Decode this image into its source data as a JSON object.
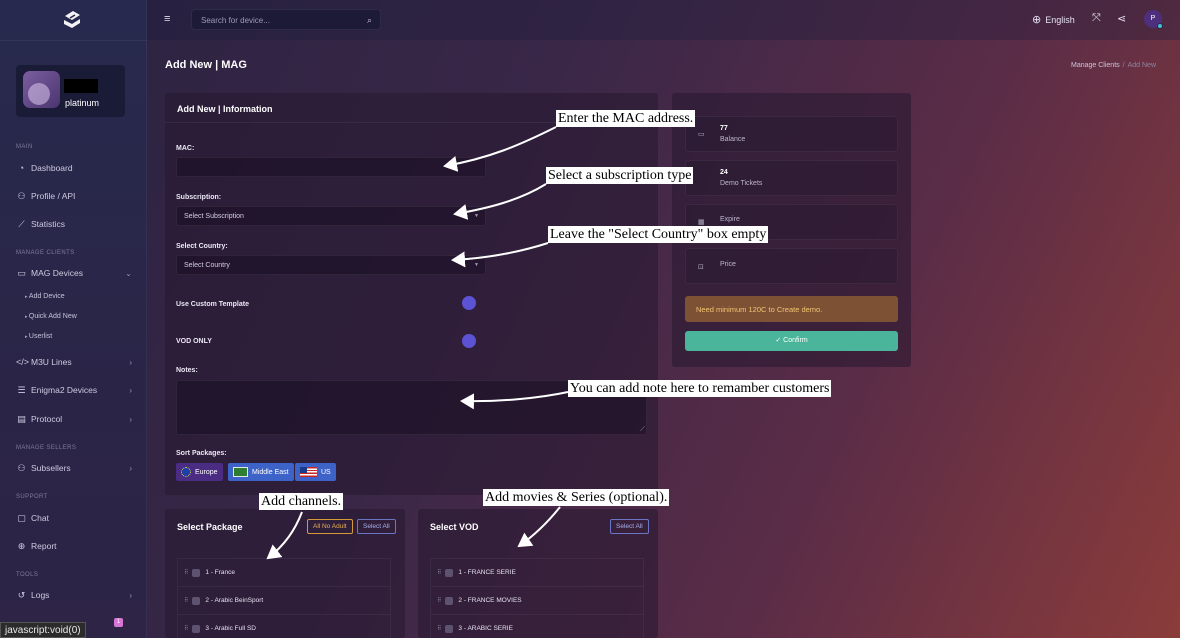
{
  "sidebar": {
    "user_plan": "platinum",
    "sections": {
      "main": "MAIN",
      "manage_clients": "MANAGE CLIENTS",
      "manage_sellers": "MANAGE SELLERS",
      "support": "SUPPORT",
      "tools": "TOOLS"
    },
    "items": {
      "dashboard": "Dashboard",
      "profile": "Profile / API",
      "statistics": "Statistics",
      "mag_devices": "MAG Devices",
      "add_device": "Add Device",
      "quick_add": "Quick Add New",
      "userlist": "Userlist",
      "m3u": "M3U Lines",
      "enigma": "Enigma2 Devices",
      "protocol": "Protocol",
      "subsellers": "Subsellers",
      "chat": "Chat",
      "report": "Report",
      "logs": "Logs"
    },
    "badge": "1"
  },
  "status_bar": "javascript:void(0)",
  "topbar": {
    "search_placeholder": "Search for device...",
    "language": "English",
    "avatar_initial": "P"
  },
  "page": {
    "title": "Add New | MAG",
    "breadcrumb": [
      "Manage Clients",
      "/",
      "Add New"
    ]
  },
  "form": {
    "card_title": "Add New | Information",
    "mac_label": "MAC:",
    "subscription_label": "Subscription:",
    "subscription_value": "Select Subscription",
    "country_label": "Select Country:",
    "country_value": "Select Country",
    "custom_template_label": "Use Custom Template",
    "vod_only_label": "VOD ONLY",
    "notes_label": "Notes:",
    "sort_label": "Sort Packages:",
    "sort_packages": [
      "Europe",
      "Middle East",
      "US"
    ]
  },
  "info": {
    "balance_value": "77",
    "balance_label": "Balance",
    "demo_value": "24",
    "demo_label": "Demo Tickets",
    "expire_label": "Expire",
    "price_label": "Price",
    "warning": "Need minimum 120C to Create demo.",
    "confirm": "Confirm"
  },
  "packages": {
    "title": "Select Package",
    "btn_no_adult": "All No Adult",
    "btn_select_all": "Select All",
    "rows": [
      "1 - France",
      "2 - Arabic BeinSport",
      "3 - Arabic Full SD"
    ]
  },
  "vod": {
    "title": "Select VOD",
    "btn_select_all": "Select All",
    "rows": [
      "1 - FRANCE SERIE",
      "2 - FRANCE MOVIES",
      "3 - ARABIC SERIE"
    ]
  },
  "annotations": {
    "mac": "Enter the MAC address.",
    "subscription": "Select a subscription type",
    "country": "Leave the \"Select Country\" box empty",
    "notes": "You can add note here to remamber customers",
    "channels": "Add channels.",
    "movies": "Add movies & Series (optional)."
  }
}
